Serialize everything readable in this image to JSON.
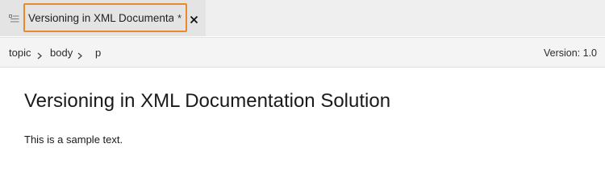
{
  "tab": {
    "title": "Versioning in XML Documentatio...",
    "dirty_marker": "*",
    "icon": "document-outline-icon",
    "close_icon": "close-icon",
    "focus_color": "#e8892b"
  },
  "breadcrumb": {
    "items": [
      "topic",
      "body",
      "p"
    ],
    "separator_icon": "chevron-right-icon"
  },
  "version_label": "Version: 1.0",
  "document": {
    "title": "Versioning in XML Documentation Solution",
    "paragraph": "This is a sample text."
  }
}
